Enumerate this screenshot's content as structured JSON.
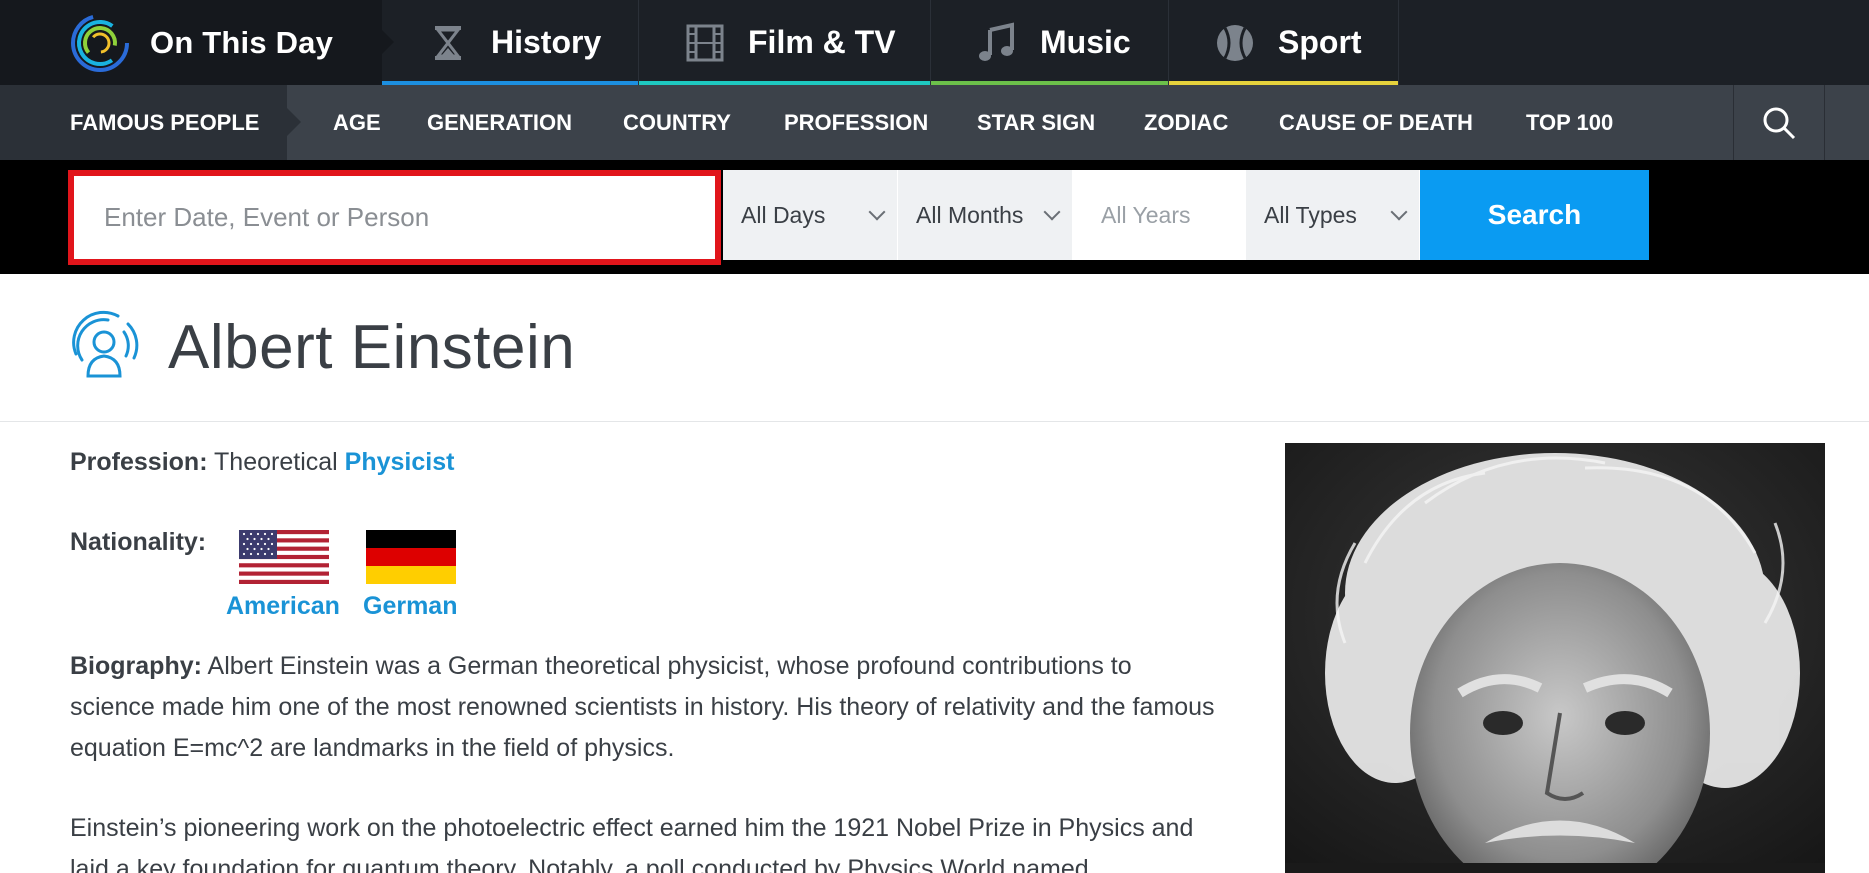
{
  "brand": {
    "name": "On This Day"
  },
  "categories": [
    {
      "label": "History",
      "icon": "hourglass-icon",
      "color": "#1c8fe0"
    },
    {
      "label": "Film & TV",
      "icon": "film-strip-icon",
      "color": "#1ec8c0"
    },
    {
      "label": "Music",
      "icon": "music-note-icon",
      "color": "#6cc04a"
    },
    {
      "label": "Sport",
      "icon": "tennis-ball-icon",
      "color": "#e6d23c"
    }
  ],
  "subnav": {
    "current": "FAMOUS PEOPLE",
    "links": [
      "AGE",
      "GENERATION",
      "COUNTRY",
      "PROFESSION",
      "STAR SIGN",
      "ZODIAC",
      "CAUSE OF DEATH",
      "TOP 100"
    ],
    "search_icon": "search-icon"
  },
  "search": {
    "placeholder": "Enter Date, Event or Person",
    "days": "All Days",
    "months": "All Months",
    "years_placeholder": "All Years",
    "types": "All Types",
    "button": "Search"
  },
  "person": {
    "name": "Albert Einstein",
    "profession_label": "Profession:",
    "profession_prefix": "Theoretical",
    "profession_link": "Physicist",
    "nationality_label": "Nationality:",
    "nationalities": [
      "American",
      "German"
    ],
    "biography_label": "Biography:",
    "biography_p1": "Albert Einstein was a German theoretical physicist, whose profound contributions to science made him one of the most renowned scientists in history. His theory of relativity and the famous equation E=mc^2 are landmarks in the field of physics.",
    "biography_p2": "Einstein’s pioneering work on the photoelectric effect earned him the 1921 Nobel Prize in Physics and laid a key foundation for quantum theory. Notably, a poll conducted by Physics World named"
  },
  "colors": {
    "accent": "#1a93d6",
    "search_button": "#0a9bf2",
    "highlight": "#e1151b"
  }
}
